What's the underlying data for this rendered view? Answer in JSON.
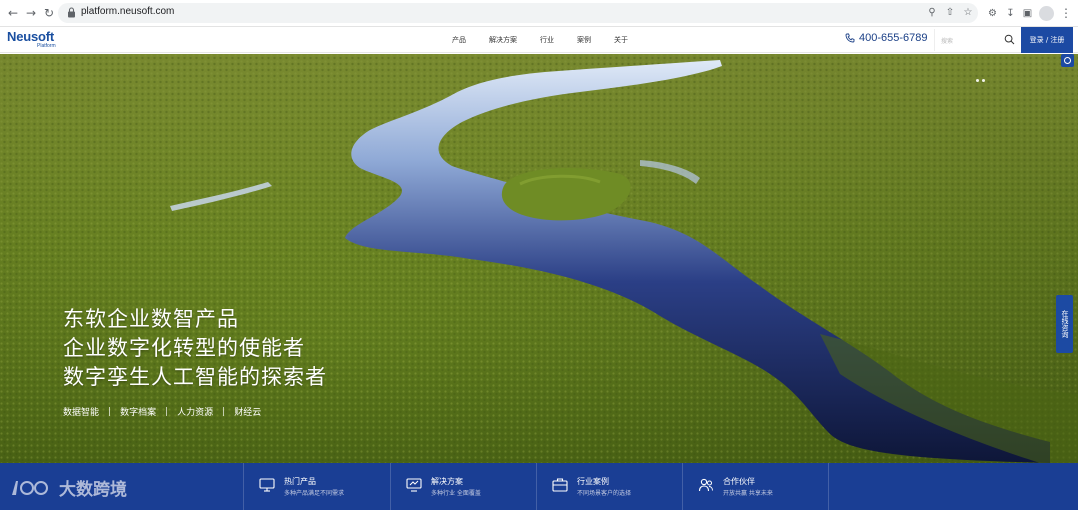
{
  "browser": {
    "url": "platform.neusoft.com"
  },
  "header": {
    "logo_brand": "Neusoft",
    "logo_sub": "Platform",
    "nav": [
      "产品",
      "解决方案",
      "行业",
      "案例",
      "关于"
    ],
    "phone": "400-655-6789",
    "search_placeholder": "搜索",
    "login_label": "登录 / 注册"
  },
  "hero": {
    "title_lines": [
      "东软企业数智产品",
      "企业数字化转型的使能者",
      "数字孪生人工智能的探索者"
    ],
    "tags": [
      "数据智能",
      "数字档案",
      "人力资源",
      "财经云"
    ],
    "side_label": "在线咨询"
  },
  "feature_bar": {
    "watermark": "大数跨境",
    "items": [
      {
        "title": "热门产品",
        "desc": "多种产品满足不同需求"
      },
      {
        "title": "解决方案",
        "desc": "多种行业  全面覆盖"
      },
      {
        "title": "行业案例",
        "desc": "不同场景客户的选择"
      },
      {
        "title": "合作伙伴",
        "desc": "开放共赢  共享未来"
      }
    ]
  },
  "colors": {
    "brand_blue": "#1a4fa0",
    "bar_blue": "#1a3e94",
    "grass": "#6e8a22",
    "water": "#1b2c66"
  }
}
